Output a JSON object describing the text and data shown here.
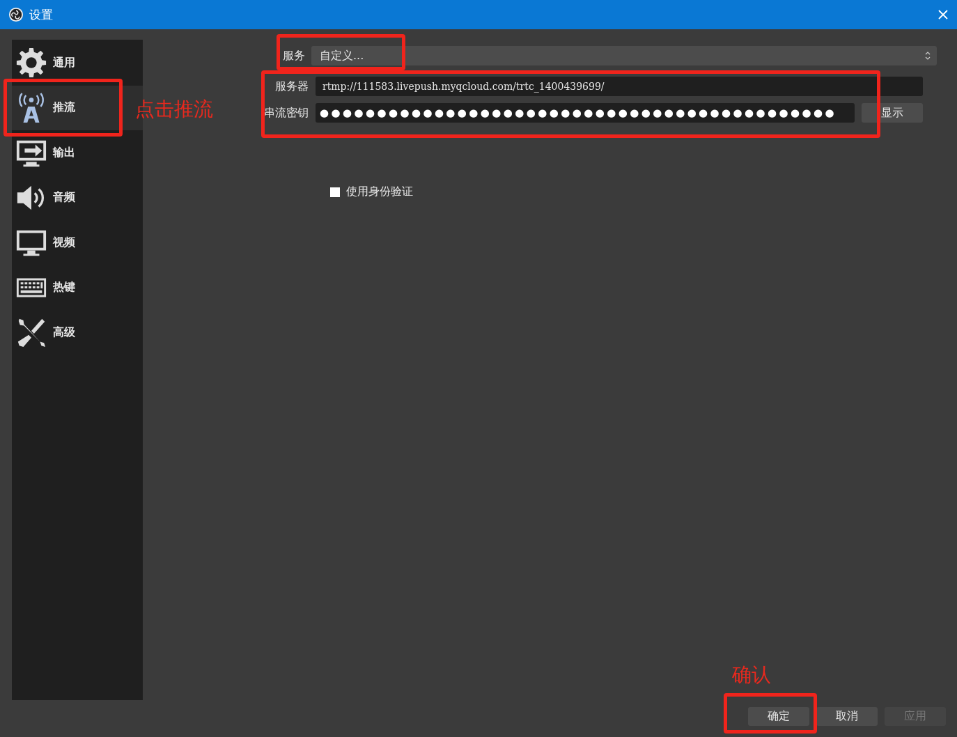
{
  "window": {
    "title": "设置"
  },
  "sidebar": {
    "items": [
      {
        "label": "通用",
        "selected": false
      },
      {
        "label": "推流",
        "selected": true
      },
      {
        "label": "输出",
        "selected": false
      },
      {
        "label": "音频",
        "selected": false
      },
      {
        "label": "视频",
        "selected": false
      },
      {
        "label": "热键",
        "selected": false
      },
      {
        "label": "高级",
        "selected": false
      }
    ]
  },
  "stream": {
    "service": {
      "label": "服务",
      "value": "自定义..."
    },
    "server": {
      "label": "服务器",
      "value": "rtmp://111583.livepush.myqcloud.com/trtc_1400439699/"
    },
    "key": {
      "label": "串流密钥",
      "value": "●●●●●●●●●●●●●●●●●●●●●●●●●●●●●●●●●●●●●●●●●●●●●",
      "show_button": "显示"
    },
    "auth": {
      "label": "使用身份验证",
      "checked": false
    }
  },
  "buttons": [
    {
      "label": "确定",
      "disabled": false
    },
    {
      "label": "取消",
      "disabled": false
    },
    {
      "label": "应用",
      "disabled": true
    }
  ],
  "annotations": [
    {
      "text": "点击推流"
    },
    {
      "text": "确认"
    }
  ]
}
